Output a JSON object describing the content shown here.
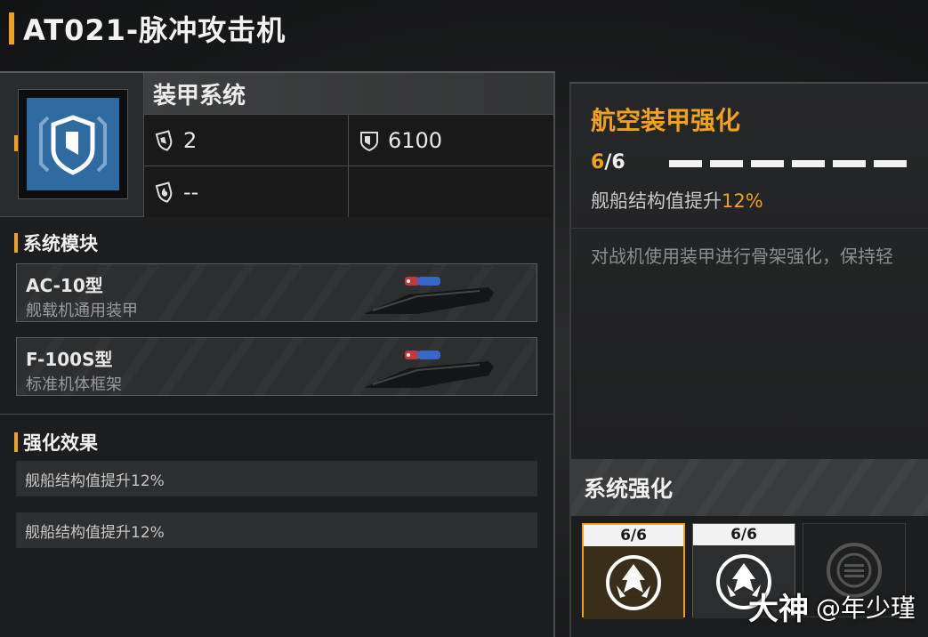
{
  "header": {
    "title": "AT021-脉冲攻击机"
  },
  "armor": {
    "title": "装甲系统",
    "stats": [
      {
        "icon": "tilt-shield-icon",
        "value": "2"
      },
      {
        "icon": "shield-icon",
        "value": "6100"
      },
      {
        "icon": "fire-shield-icon",
        "value": "--"
      },
      {
        "icon": "",
        "value": ""
      }
    ]
  },
  "modules": {
    "title": "系统模块",
    "items": [
      {
        "name": "AC-10型",
        "desc": "舰载机通用装甲"
      },
      {
        "name": "F-100S型",
        "desc": "标准机体框架"
      }
    ]
  },
  "effects": {
    "title": "强化效果",
    "items": [
      "舰船结构值提升12%",
      "舰船结构值提升12%"
    ]
  },
  "detail": {
    "title": "航空装甲强化",
    "level_current": "6",
    "level_max": "/6",
    "pips_filled": 6,
    "pips_total": 6,
    "effect_text": "舰船结构值提升",
    "effect_pct": "12%",
    "description": "对战机使用装甲进行骨架强化，保持轻"
  },
  "system_upgrade": {
    "title": "系统强化",
    "slots": [
      {
        "level": "6/6",
        "state": "selected",
        "icon": "emblem-icon"
      },
      {
        "level": "6/6",
        "state": "normal",
        "icon": "emblem-icon"
      },
      {
        "level": "",
        "state": "empty",
        "icon": "locked-slot-icon"
      }
    ]
  },
  "watermark": {
    "logo": "大神",
    "user": "@年少瑾"
  },
  "colors": {
    "accent": "#f0a21c",
    "icon_bg": "#2f6aa0"
  }
}
